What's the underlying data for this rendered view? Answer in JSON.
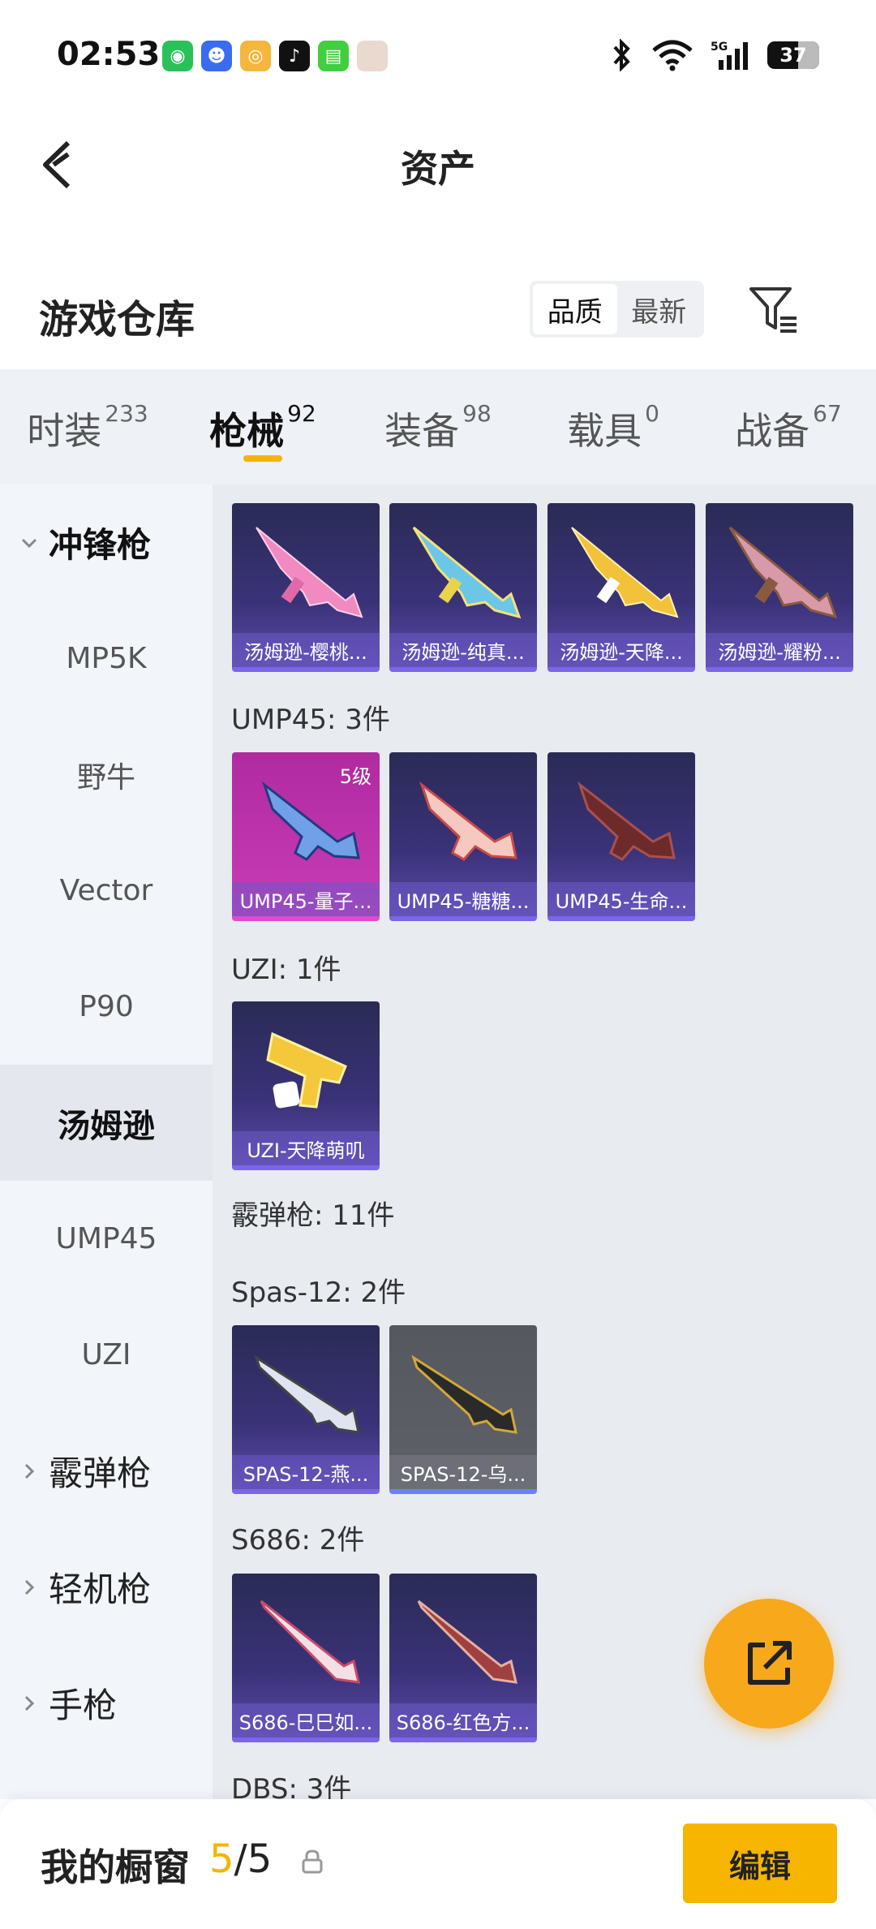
{
  "status_bar": {
    "time": "02:53",
    "battery": "37",
    "network": "5G"
  },
  "header": {
    "title": "资产"
  },
  "warehouse": {
    "title": "游戏仓库",
    "sort_options": [
      "品质",
      "最新"
    ],
    "sort_selected": "品质"
  },
  "tabs": [
    {
      "label": "时装",
      "count": "233"
    },
    {
      "label": "枪械",
      "count": "92"
    },
    {
      "label": "装备",
      "count": "98"
    },
    {
      "label": "载具",
      "count": "0"
    },
    {
      "label": "战备",
      "count": "67"
    }
  ],
  "active_tab": "枪械",
  "sidebar": {
    "items": [
      {
        "label": "冲锋枪"
      },
      {
        "label": "MP5K"
      },
      {
        "label": "野牛"
      },
      {
        "label": "Vector"
      },
      {
        "label": "P90"
      },
      {
        "label": "汤姆逊"
      },
      {
        "label": "UMP45"
      },
      {
        "label": "UZI"
      },
      {
        "label": "霰弹枪"
      },
      {
        "label": "轻机枪"
      },
      {
        "label": "手枪"
      }
    ],
    "active": "汤姆逊"
  },
  "main": {
    "thompson_cards": [
      "汤姆逊-樱桃...",
      "汤姆逊-纯真...",
      "汤姆逊-天降...",
      "汤姆逊-耀粉..."
    ],
    "ump45_label": "UMP45: 3件",
    "ump45_cards": [
      "UMP45-量子...",
      "UMP45-糖糖...",
      "UMP45-生命..."
    ],
    "ump45_level": "5级",
    "uzi_label": "UZI: 1件",
    "uzi_cards": [
      "UZI-天降萌叽"
    ],
    "shotgun_label": "霰弹枪: 11件",
    "spas_label": "Spas-12: 2件",
    "spas_cards": [
      "SPAS-12-燕...",
      "SPAS-12-乌..."
    ],
    "s686_label": "S686: 2件",
    "s686_cards": [
      "S686-巳巳如...",
      "S686-红色方..."
    ],
    "dbs_label": "DBS: 3件"
  },
  "bottom_bar": {
    "label": "我的橱窗",
    "used": "5",
    "total": "/5",
    "edit_label": "编辑"
  }
}
